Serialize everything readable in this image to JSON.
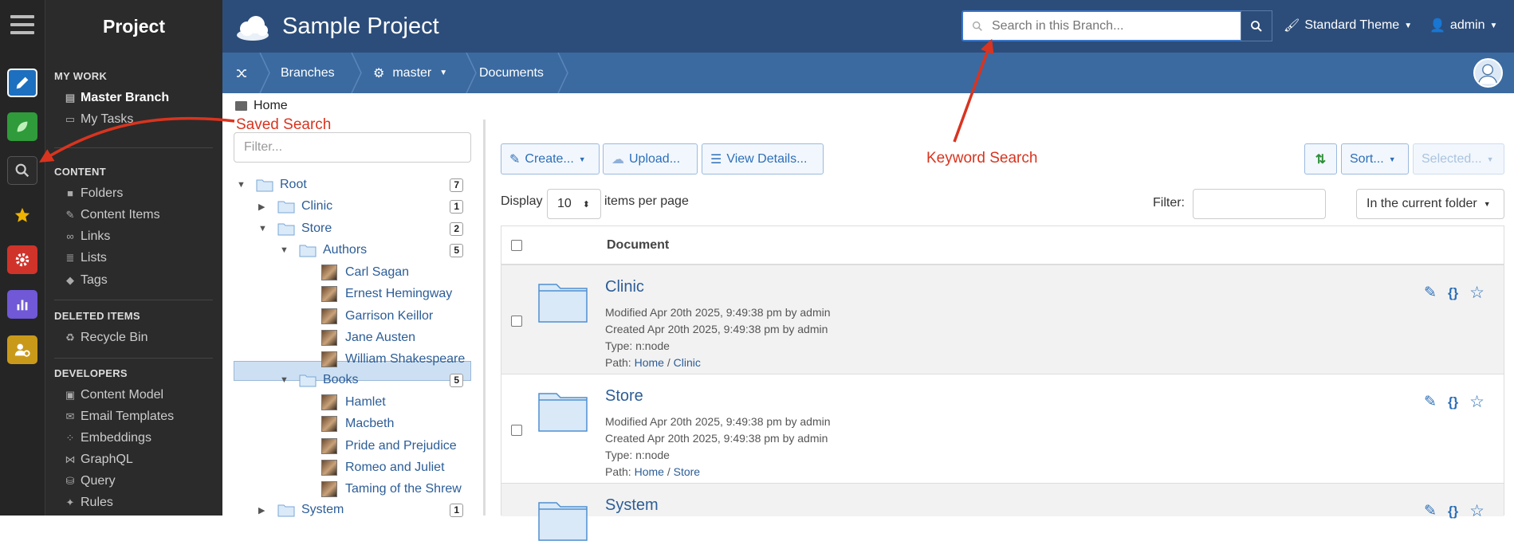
{
  "app": {
    "sidebar_title": "Project",
    "project_name": "Sample Project"
  },
  "header": {
    "search_placeholder": "Search in this Branch...",
    "theme_label": "Standard Theme",
    "user_label": "admin"
  },
  "breadcrumb": {
    "branches": "Branches",
    "branch": "master",
    "documents": "Documents"
  },
  "home_label": "Home",
  "sidebar": {
    "my_work": "MY WORK",
    "master_branch": "Master Branch",
    "my_tasks": "My Tasks",
    "content": "CONTENT",
    "folders": "Folders",
    "content_items": "Content Items",
    "links": "Links",
    "lists": "Lists",
    "tags": "Tags",
    "deleted_items": "DELETED ITEMS",
    "recycle_bin": "Recycle Bin",
    "developers": "DEVELOPERS",
    "content_model": "Content Model",
    "email_templates": "Email Templates",
    "embeddings": "Embeddings",
    "graphql": "GraphQL",
    "query": "Query",
    "rules": "Rules"
  },
  "tree": {
    "filter_placeholder": "Filter...",
    "root": {
      "label": "Root",
      "count": "7"
    },
    "clinic": {
      "label": "Clinic",
      "count": "1"
    },
    "store": {
      "label": "Store",
      "count": "2"
    },
    "authors": {
      "label": "Authors",
      "count": "5"
    },
    "author_items": [
      "Carl Sagan",
      "Ernest Hemingway",
      "Garrison Keillor",
      "Jane Austen",
      "William Shakespeare"
    ],
    "books": {
      "label": "Books",
      "count": "5"
    },
    "book_items": [
      "Hamlet",
      "Macbeth",
      "Pride and Prejudice",
      "Romeo and Juliet",
      "Taming of the Shrew"
    ],
    "system": {
      "label": "System",
      "count": "1"
    }
  },
  "toolbar": {
    "create": "Create...",
    "upload": "Upload...",
    "view_details": "View Details...",
    "sort": "Sort...",
    "selected": "Selected..."
  },
  "paging": {
    "display": "Display",
    "per_page_value": "10",
    "items_per_page": "items per page",
    "filter": "Filter:",
    "scope": "In the current folder"
  },
  "table": {
    "header": "Document"
  },
  "rows": [
    {
      "title": "Clinic",
      "modified": "Modified Apr 20th 2025, 9:49:38 pm by admin",
      "created": "Created Apr 20th 2025, 9:49:38 pm by admin",
      "type": "Type: n:node",
      "path_prefix": "Path: ",
      "path_home": "Home",
      "path_sep": " / ",
      "path_leaf": "Clinic"
    },
    {
      "title": "Store",
      "modified": "Modified Apr 20th 2025, 9:49:38 pm by admin",
      "created": "Created Apr 20th 2025, 9:49:38 pm by admin",
      "type": "Type: n:node",
      "path_prefix": "Path: ",
      "path_home": "Home",
      "path_sep": " / ",
      "path_leaf": "Store"
    },
    {
      "title": "System"
    }
  ],
  "annotations": {
    "saved_search": "Saved Search",
    "keyword_search": "Keyword Search"
  },
  "colors": {
    "accent": "#2c4d7a",
    "annotation": "#d9341f"
  }
}
